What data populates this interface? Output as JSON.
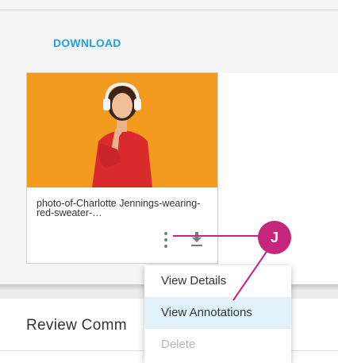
{
  "toolbar": {
    "download_label": "DOWNLOAD"
  },
  "asset_card": {
    "title": "photo-of-Charlotte Jennings-wearing-red-sweater-…",
    "thumbnail_alt": "Woman in red sweater wearing headphones on orange background"
  },
  "context_menu": {
    "items": [
      {
        "label": "View Details",
        "state": "normal"
      },
      {
        "label": "View Annotations",
        "state": "highlighted"
      },
      {
        "label": "Delete",
        "state": "disabled"
      }
    ]
  },
  "review_section": {
    "title": "Review Comm"
  },
  "callout": {
    "label": "J",
    "color": "#c4277c"
  },
  "colors": {
    "accent_link": "#1ea0e6",
    "menu_highlight": "#e0f1fa",
    "thumbnail_background": "#f29b1f",
    "callout": "#c4277c"
  }
}
